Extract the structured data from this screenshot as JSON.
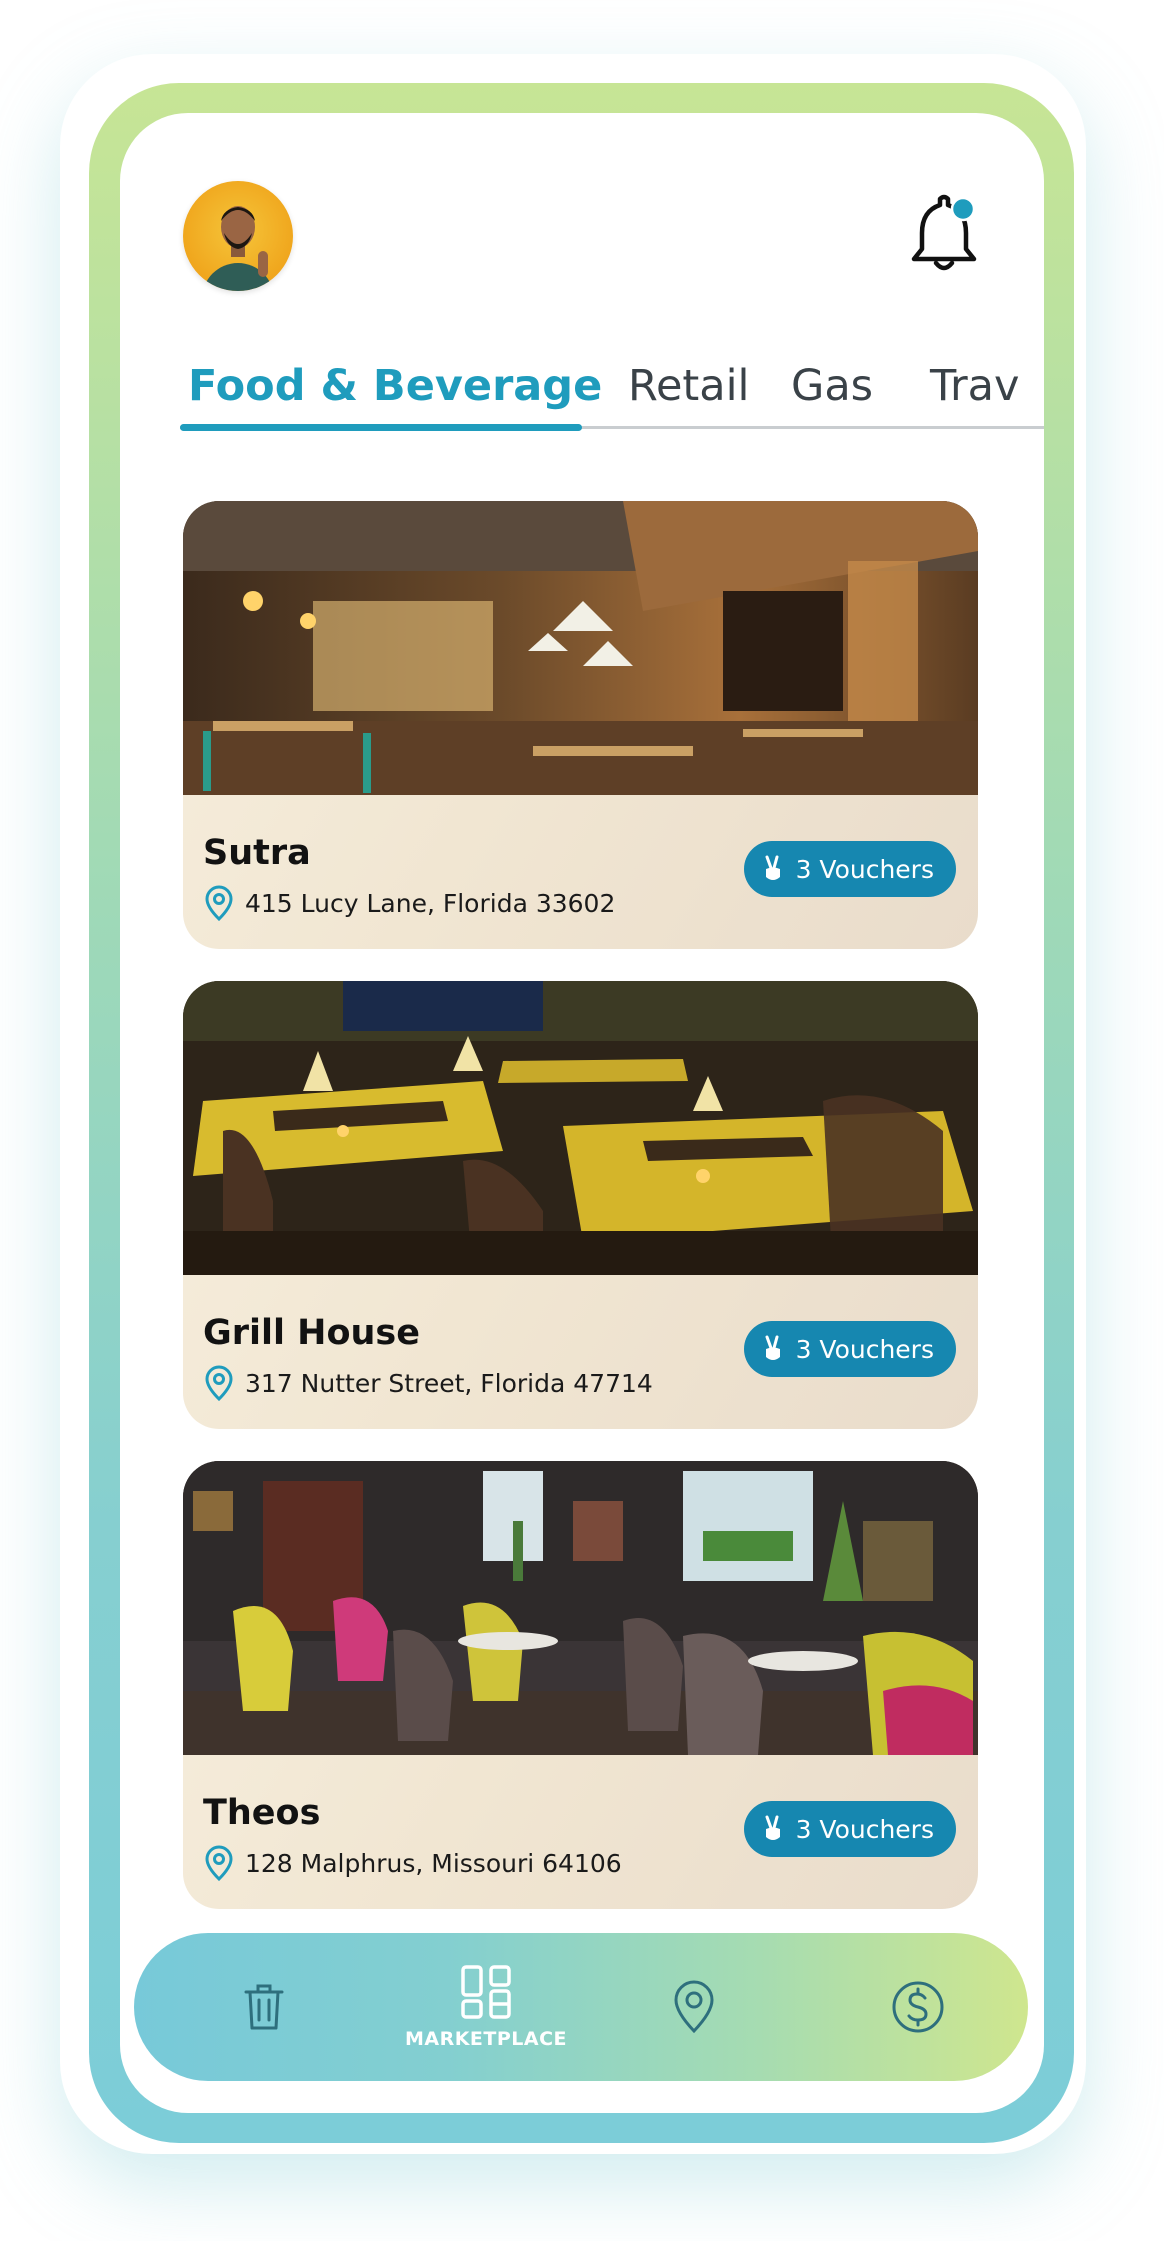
{
  "tabs": [
    {
      "label": "Food & Beverage",
      "active": true
    },
    {
      "label": "Retail",
      "active": false
    },
    {
      "label": "Gas",
      "active": false
    },
    {
      "label": "Trav",
      "active": false
    }
  ],
  "accent_color": "#1f9cbd",
  "voucher_color": "#1687b0",
  "notification_dot_color": "#1f9cbd",
  "cards": [
    {
      "name": "Sutra",
      "address": "415 Lucy Lane, Florida 33602",
      "vouchers": "3 Vouchers"
    },
    {
      "name": "Grill House",
      "address": "317 Nutter Street, Florida 47714",
      "vouchers": "3 Vouchers"
    },
    {
      "name": "Theos",
      "address": "128 Malphrus, Missouri 64106",
      "vouchers": "3 Vouchers"
    }
  ],
  "nav": {
    "items": [
      {
        "icon": "trash-icon",
        "label": ""
      },
      {
        "icon": "grid-icon",
        "label": "MARKETPLACE"
      },
      {
        "icon": "location-pin-icon",
        "label": ""
      },
      {
        "icon": "dollar-icon",
        "label": ""
      }
    ]
  }
}
